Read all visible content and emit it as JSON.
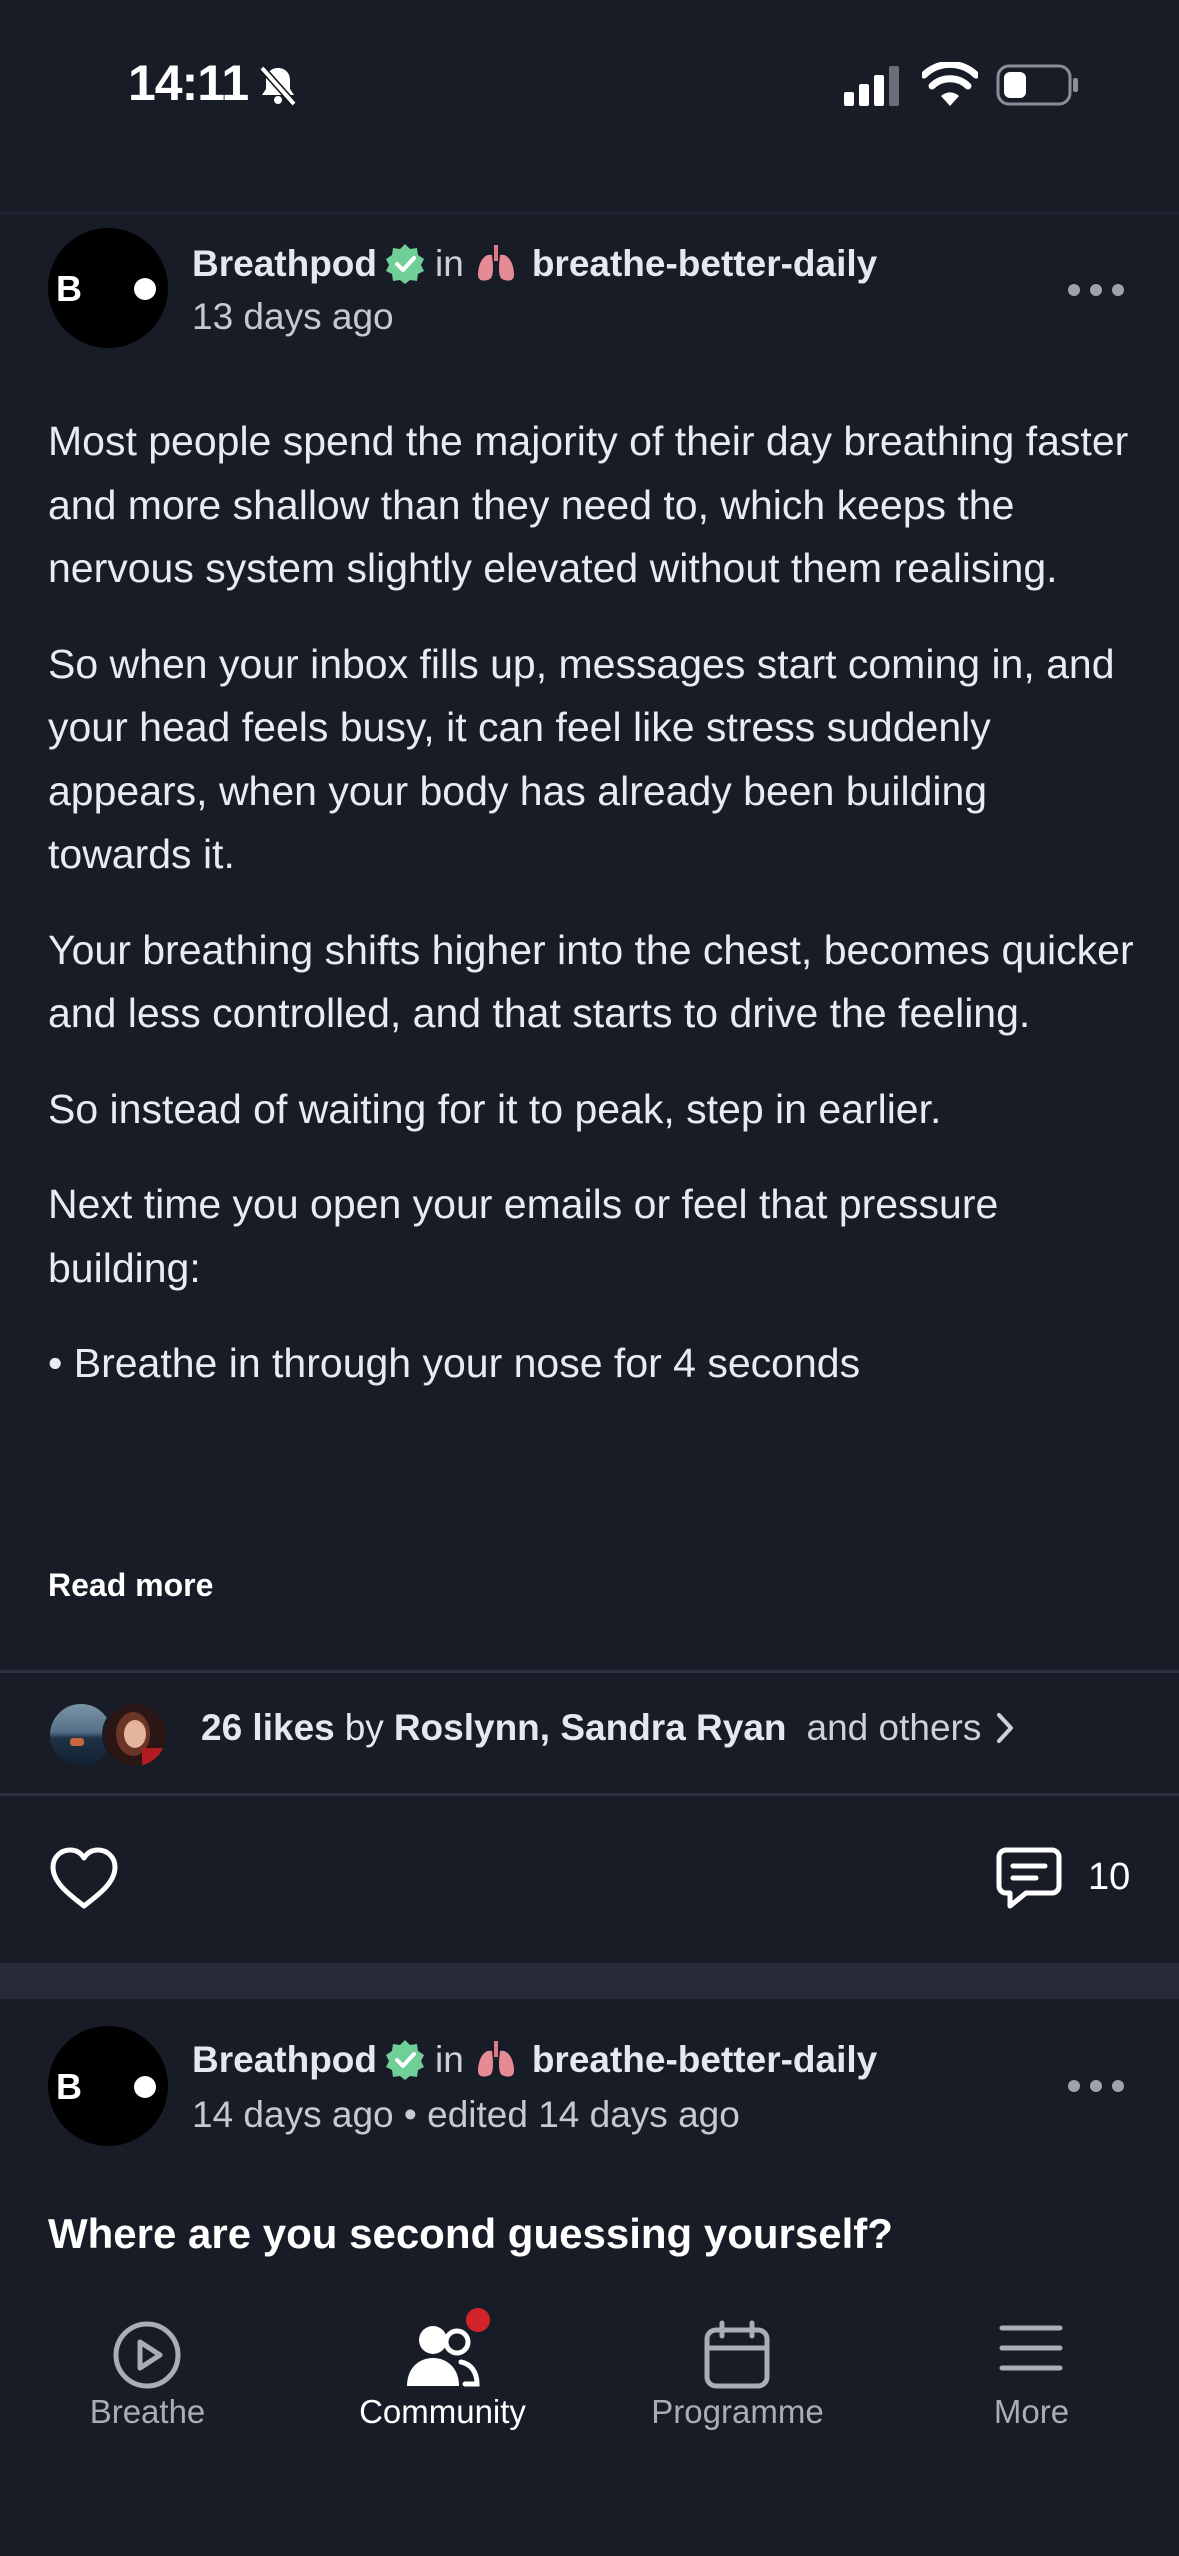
{
  "status_bar": {
    "time": "14:11",
    "icons": [
      "bell-slash-icon",
      "signal-icon",
      "wifi-icon",
      "battery-icon"
    ]
  },
  "post1": {
    "author": "Breathpod",
    "avatar_letter": "B",
    "in_word": "in",
    "community_emoji": "lungs-icon",
    "community": "breathe-better-daily",
    "timestamp": "13 days ago",
    "paragraphs": [
      "Most people spend the majority of their day breathing faster and more shallow than they need to, which keeps the nervous system slightly elevated without them realising.",
      "So when your inbox fills up, messages start coming in, and your head feels busy, it can feel like stress suddenly appears, when your body has already been building towards it.",
      "Your breathing shifts higher into the chest, becomes quicker and less controlled, and that starts to drive the feeling.",
      "So instead of waiting for it to peak, step in earlier.",
      "Next time you open your emails or feel that pressure building:",
      "• Breathe in through your nose for 4 seconds"
    ],
    "read_more": "Read more",
    "likes": {
      "count_text": "26 likes",
      "by_word": "by",
      "names": "Roslynn, Sandra Ryan",
      "others": "and others"
    },
    "comment_count": "10"
  },
  "post2": {
    "author": "Breathpod",
    "avatar_letter": "B",
    "in_word": "in",
    "community": "breathe-better-daily",
    "timestamp": "14 days ago • edited 14 days ago",
    "title": "Where are you second guessing yourself?"
  },
  "bottom_nav": {
    "items": [
      {
        "label": "Breathe",
        "icon": "play-circle-icon",
        "active": false
      },
      {
        "label": "Community",
        "icon": "people-icon",
        "active": true,
        "badge": true
      },
      {
        "label": "Programme",
        "icon": "calendar-icon",
        "active": false
      },
      {
        "label": "More",
        "icon": "menu-icon",
        "active": false
      }
    ]
  },
  "colors": {
    "background": "#181c26",
    "verified": "#6fcf97",
    "badge": "#d0232a",
    "divider": "#2c3140"
  }
}
